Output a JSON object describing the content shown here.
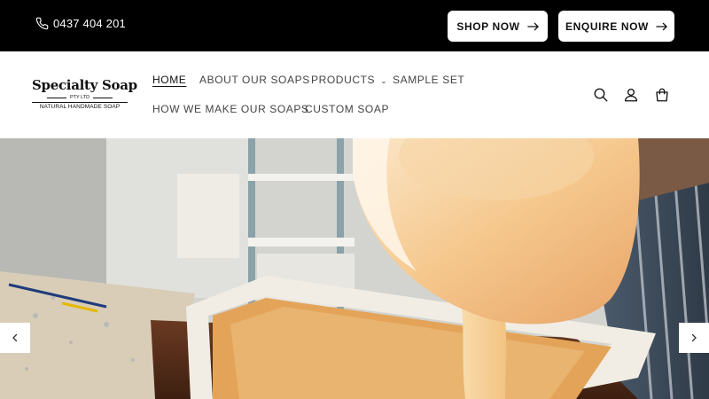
{
  "topbar": {
    "phone": "0437 404 201",
    "shop_label": "SHOP NOW",
    "enquire_label": "ENQUIRE NOW"
  },
  "logo": {
    "name": "Specialty Soap",
    "sub": "PTY LTD",
    "tagline": "NATURAL HANDMADE SOAP"
  },
  "nav": {
    "items": [
      {
        "label": "HOME"
      },
      {
        "label": "ABOUT OUR SOAPS"
      },
      {
        "label": "PRODUCTS"
      },
      {
        "label": "SAMPLE SET"
      },
      {
        "label": "HOW WE MAKE OUR SOAPS"
      },
      {
        "label": "CUSTOM SOAP"
      }
    ]
  },
  "icons": [
    "search-icon",
    "account-icon",
    "cart-icon",
    "phone-icon",
    "arrow-right-icon",
    "chevron-down-icon",
    "chevron-left-icon",
    "chevron-right-icon"
  ],
  "colors": {
    "topbar": "#000000",
    "button_bg": "#ffffff",
    "nav_text": "#444444"
  }
}
